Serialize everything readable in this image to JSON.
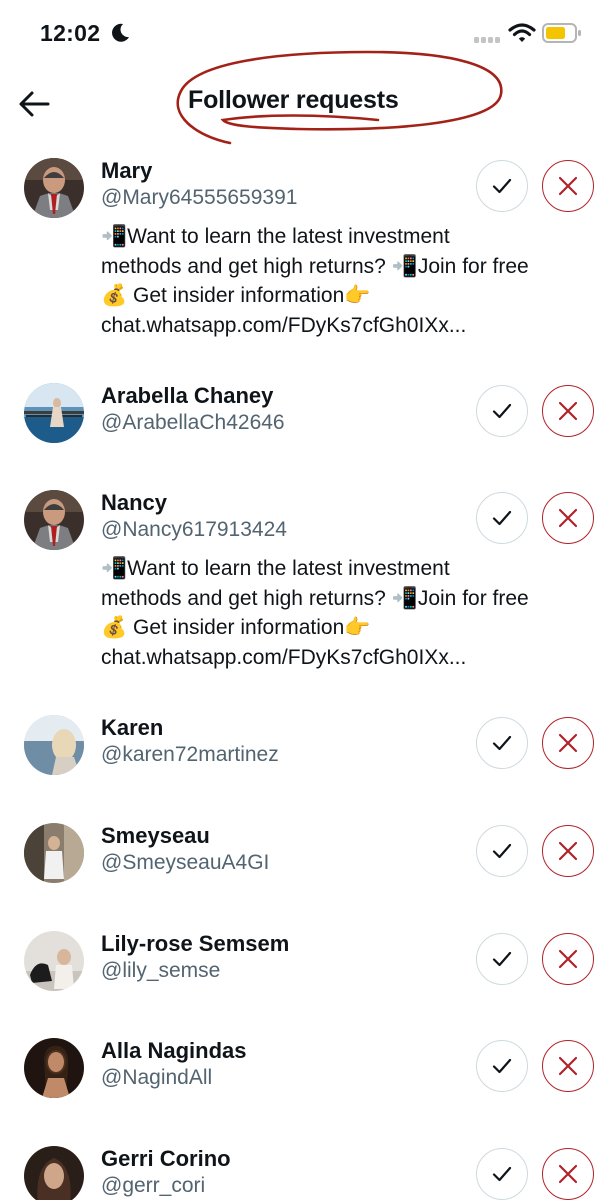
{
  "status_bar": {
    "time": "12:02"
  },
  "header": {
    "title": "Follower requests"
  },
  "colors": {
    "accent_decline": "#b0232b",
    "accept_border": "#cfd9de",
    "handle_text": "#536471",
    "annotation_ink": "#a32218"
  },
  "requests": [
    {
      "name": "Mary",
      "handle": "@Mary64555659391",
      "bio": "📲Want to learn the latest investment\nmethods and get high returns? 📲Join for free\n💰 Get insider information👉\nchat.whatsapp.com/FDyKs7cfGh0IXx..."
    },
    {
      "name": "Arabella Chaney",
      "handle": "@ArabellaCh42646",
      "bio": ""
    },
    {
      "name": "Nancy",
      "handle": "@Nancy617913424",
      "bio": "📲Want to learn the latest investment\nmethods and get high returns? 📲Join for free\n💰 Get insider information👉\nchat.whatsapp.com/FDyKs7cfGh0IXx..."
    },
    {
      "name": "Karen",
      "handle": "@karen72martinez",
      "bio": ""
    },
    {
      "name": "Smeyseau",
      "handle": "@SmeyseauA4GI",
      "bio": ""
    },
    {
      "name": "Lily-rose Semsem",
      "handle": "@lily_semse",
      "bio": ""
    },
    {
      "name": "Alla Nagindas",
      "handle": "@NagindAll",
      "bio": ""
    },
    {
      "name": "Gerri Corino",
      "handle": "@gerr_cori",
      "bio": ""
    }
  ]
}
